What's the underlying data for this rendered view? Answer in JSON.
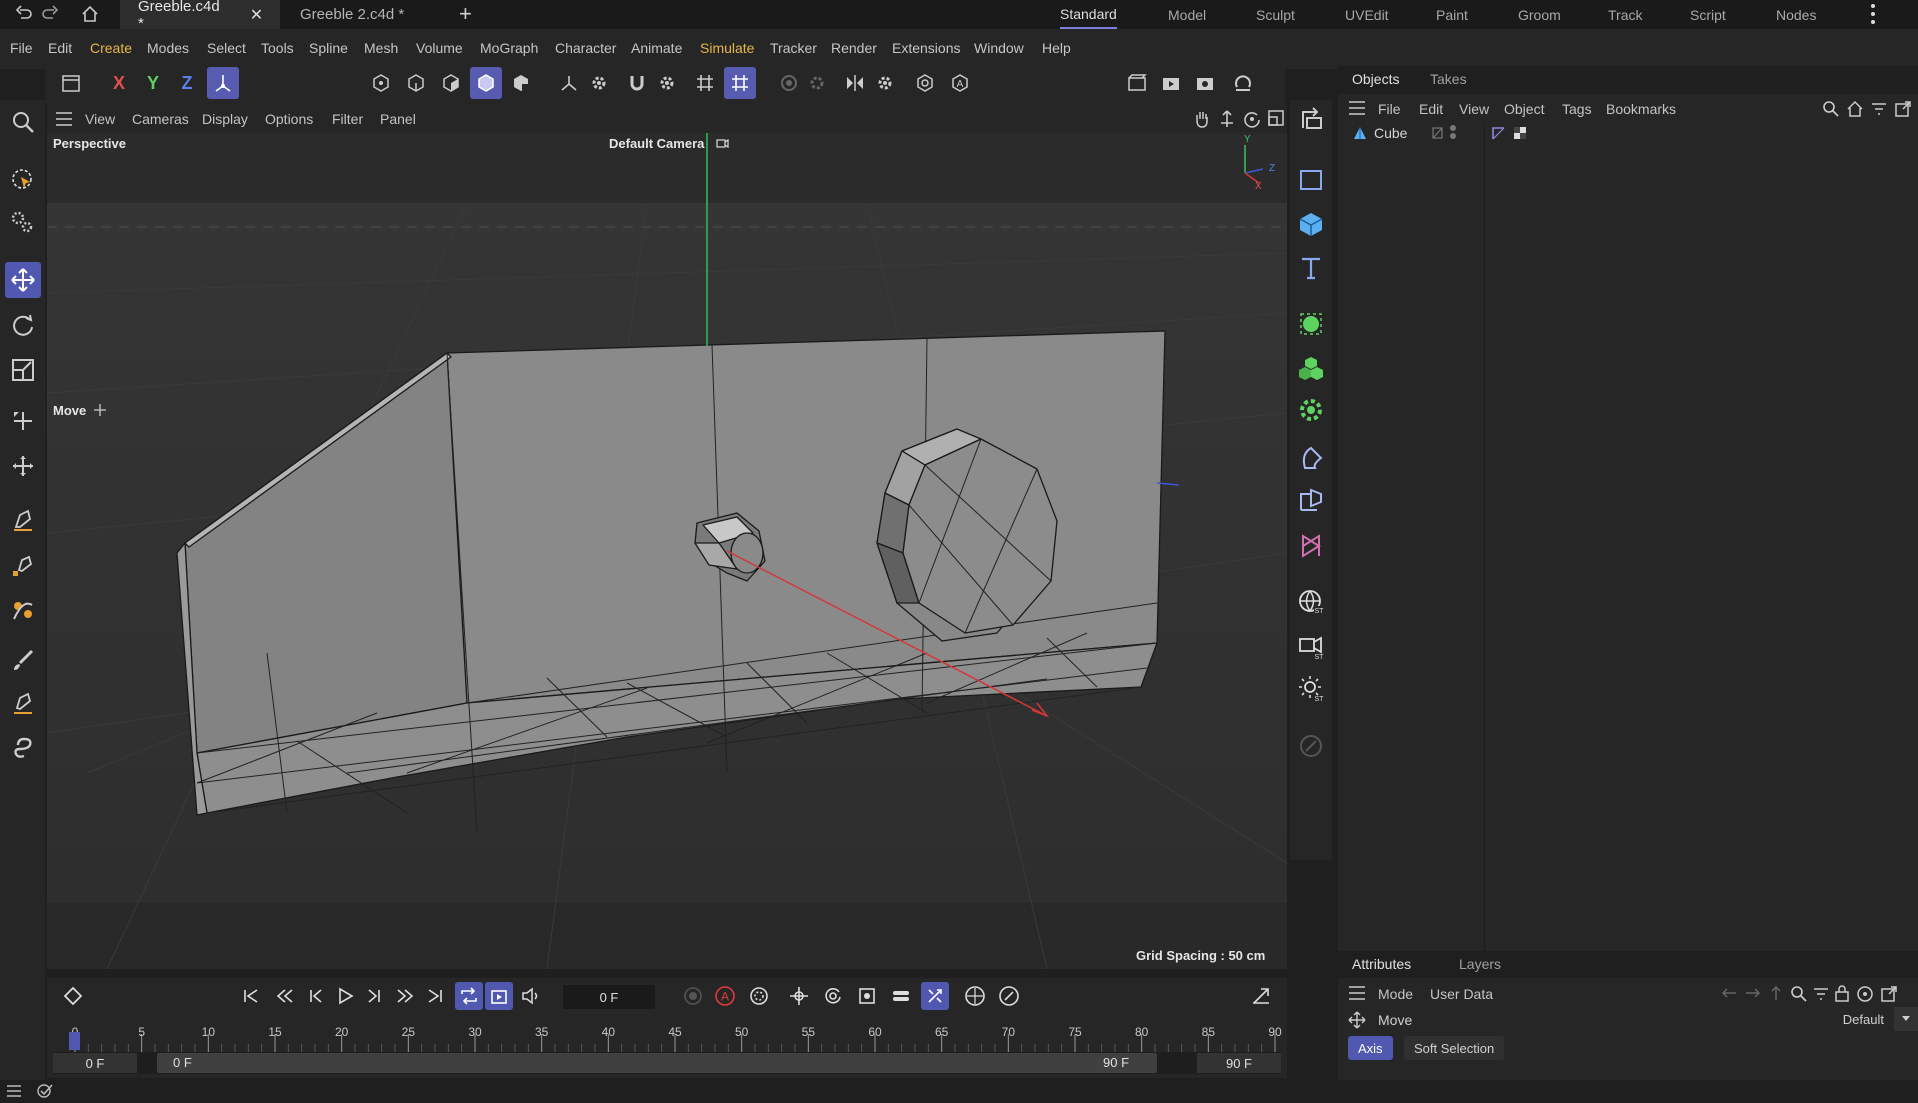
{
  "topbar": {
    "undo_icon": "undo-icon",
    "redo_icon": "redo-icon",
    "home_icon": "home-icon",
    "tabs": [
      {
        "label": "Greeble.c4d *",
        "active": true
      },
      {
        "label": "Greeble 2.c4d *",
        "active": false
      }
    ],
    "close_glyph": "✕",
    "add_tab_glyph": "+",
    "layouts": [
      "Standard",
      "Model",
      "Sculpt",
      "UVEdit",
      "Paint",
      "Groom",
      "Track",
      "Script",
      "Nodes"
    ],
    "active_layout": "Standard",
    "more_icon": "vertical-dots-icon"
  },
  "menubar": {
    "items": [
      "File",
      "Edit",
      "Create",
      "Modes",
      "Select",
      "Tools",
      "Spline",
      "Mesh",
      "Volume",
      "MoGraph",
      "Character",
      "Animate",
      "Simulate",
      "Tracker",
      "Render",
      "Extensions",
      "Window",
      "Help"
    ],
    "highlighted": [
      "Create",
      "Simulate"
    ]
  },
  "axis_toggles": [
    "X",
    "Y",
    "Z"
  ],
  "viewport": {
    "menu": [
      "View",
      "Cameras",
      "Display",
      "Options",
      "Filter",
      "Panel"
    ],
    "view_name": "Perspective",
    "camera": "Default Camera",
    "tool_label": "Move",
    "grid_spacing": "Grid Spacing : 50 cm",
    "axis_y": "Y",
    "axis_z": "Z",
    "axis_x": "X"
  },
  "objects_panel": {
    "tabs": [
      "Objects",
      "Takes"
    ],
    "active_tab": "Objects",
    "menu": [
      "File",
      "Edit",
      "View",
      "Object",
      "Tags",
      "Bookmarks"
    ],
    "objects": [
      {
        "name": "Cube"
      }
    ]
  },
  "attributes_panel": {
    "tabs": [
      "Attributes",
      "Layers"
    ],
    "active_tab": "Attributes",
    "menu": [
      "Mode",
      "User Data"
    ],
    "tool_name": "Move",
    "preset": "Default",
    "subtabs": [
      "Axis",
      "Soft Selection"
    ],
    "active_subtab": "Axis"
  },
  "timeline": {
    "current_frame": "0 F",
    "ruler_ticks": [
      "0",
      "5",
      "10",
      "15",
      "20",
      "25",
      "30",
      "35",
      "40",
      "45",
      "50",
      "55",
      "60",
      "65",
      "70",
      "75",
      "80",
      "85",
      "90"
    ],
    "range_start": "0 F",
    "range_preview_start": "0 F",
    "range_preview_end": "90 F",
    "range_end": "90 F"
  },
  "colors": {
    "accent": "#5058b0",
    "menu_highlight": "#e6b64a",
    "axis_x": "#d03a3a",
    "axis_y": "#3ac060",
    "axis_z": "#4060d0",
    "object_green": "#5fd35f"
  }
}
